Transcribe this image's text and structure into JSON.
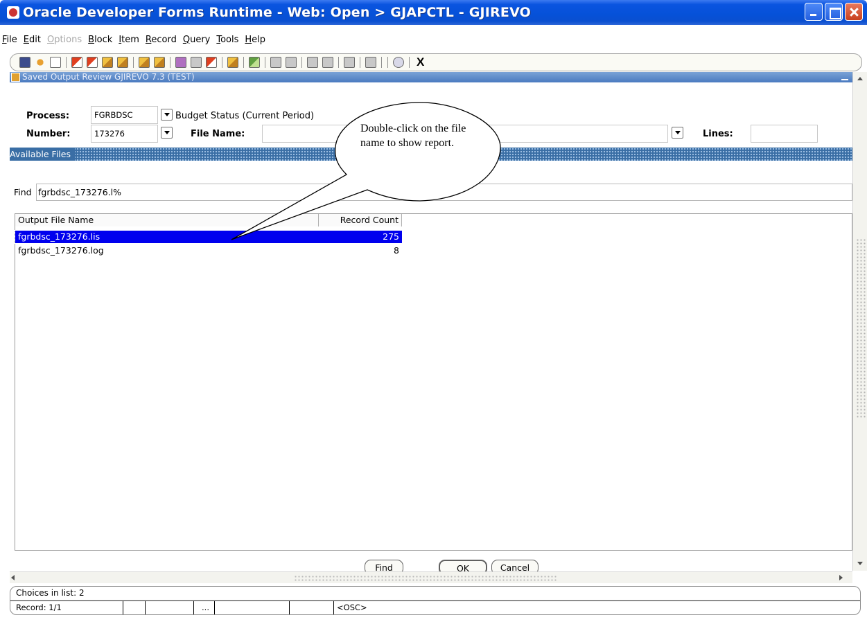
{
  "window": {
    "title": "Oracle Developer Forms Runtime - Web:  Open > GJAPCTL - GJIREVO"
  },
  "menu": [
    {
      "label": "File",
      "underline": "F",
      "rest": "ile",
      "disabled": false
    },
    {
      "label": "Edit",
      "underline": "E",
      "rest": "dit",
      "disabled": false
    },
    {
      "label": "Options",
      "underline": "O",
      "rest": "ptions",
      "disabled": true
    },
    {
      "label": "Block",
      "underline": "B",
      "rest": "lock",
      "disabled": false
    },
    {
      "label": "Item",
      "underline": "I",
      "rest": "tem",
      "disabled": false
    },
    {
      "label": "Record",
      "underline": "R",
      "rest": "ecord",
      "disabled": false
    },
    {
      "label": "Query",
      "underline": "Q",
      "rest": "uery",
      "disabled": false
    },
    {
      "label": "Tools",
      "underline": "T",
      "rest": "ools",
      "disabled": false
    },
    {
      "label": "Help",
      "underline": "H",
      "rest": "elp",
      "disabled": false
    }
  ],
  "toolbar": {
    "exit_label": "X"
  },
  "form": {
    "title": "Saved Output Review  GJIREVO  7.3  (TEST)",
    "process_label": "Process:",
    "process_value": "FGRBDSC",
    "process_desc": "Budget Status (Current Period)",
    "number_label": "Number:",
    "number_value": "173276",
    "file_name_label": "File Name:",
    "file_name_value": "",
    "lines_label": "Lines:",
    "lines_value": ""
  },
  "available_files": {
    "title": "Available Files"
  },
  "find": {
    "label": "Find",
    "value": "fgrbdsc_173276.l%"
  },
  "list": {
    "columns": [
      "Output File Name",
      "Record Count"
    ],
    "rows": [
      {
        "name": "fgrbdsc_173276.lis",
        "count": "275",
        "selected": true
      },
      {
        "name": "fgrbdsc_173276.log",
        "count": "8",
        "selected": false
      }
    ]
  },
  "buttons": {
    "find": "Find",
    "ok": "OK",
    "cancel": "Cancel"
  },
  "status": {
    "line1": "Choices in list: 2",
    "record": "Record: 1/1",
    "ellipsis": "...",
    "osc": "<OSC>"
  },
  "callout": {
    "text": "Double-click on the file name to show report."
  }
}
